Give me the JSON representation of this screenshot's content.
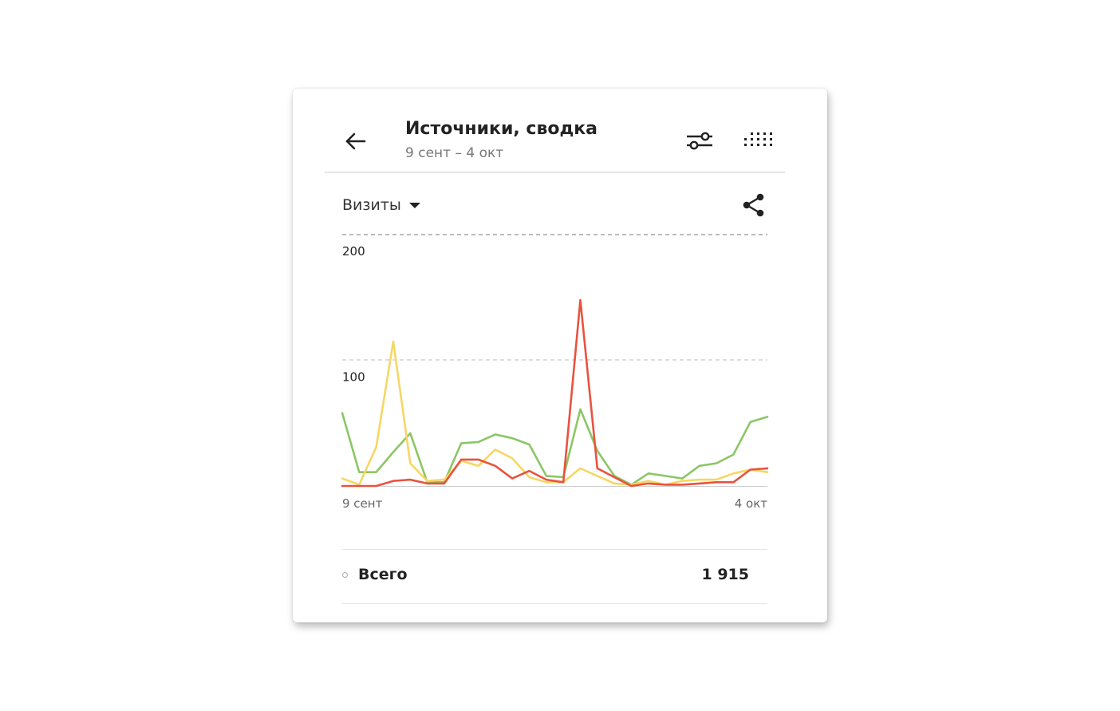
{
  "header": {
    "title": "Источники, сводка",
    "date_range": "9 сент – 4 окт"
  },
  "metric": {
    "selected": "Визиты"
  },
  "totals": {
    "label": "Всего",
    "value": "1 915"
  },
  "icons": {
    "back": "arrow-left-icon",
    "filters": "sliders-icon",
    "grouping": "dots-grid-icon",
    "share": "share-icon",
    "metric_caret": "caret-down-icon"
  },
  "colors": {
    "series_green": "#8cc665",
    "series_yellow": "#f5d764",
    "series_red": "#e8533e",
    "grid": "#bbbbbb"
  },
  "chart_data": {
    "type": "line",
    "x_start_label": "9 сент",
    "x_end_label": "4 окт",
    "yticks": [
      100,
      200
    ],
    "ylim": [
      0,
      200
    ],
    "grid": "dashed horizontal",
    "series": [
      {
        "color": "#8cc665",
        "values": [
          58,
          11,
          11,
          27,
          42,
          3,
          3,
          34,
          35,
          41,
          38,
          33,
          8,
          7,
          61,
          28,
          8,
          1,
          10,
          8,
          6,
          16,
          18,
          25,
          51,
          55
        ]
      },
      {
        "color": "#f5d764",
        "values": [
          6,
          1,
          31,
          115,
          18,
          4,
          5,
          20,
          16,
          29,
          22,
          7,
          3,
          3,
          14,
          8,
          2,
          1,
          4,
          1,
          4,
          5,
          5,
          10,
          13,
          11
        ]
      },
      {
        "color": "#e8533e",
        "values": [
          0,
          0,
          0,
          4,
          5,
          2,
          2,
          21,
          21,
          16,
          6,
          12,
          5,
          3,
          148,
          14,
          7,
          0,
          2,
          1,
          1,
          2,
          3,
          3,
          13,
          14
        ]
      }
    ]
  }
}
